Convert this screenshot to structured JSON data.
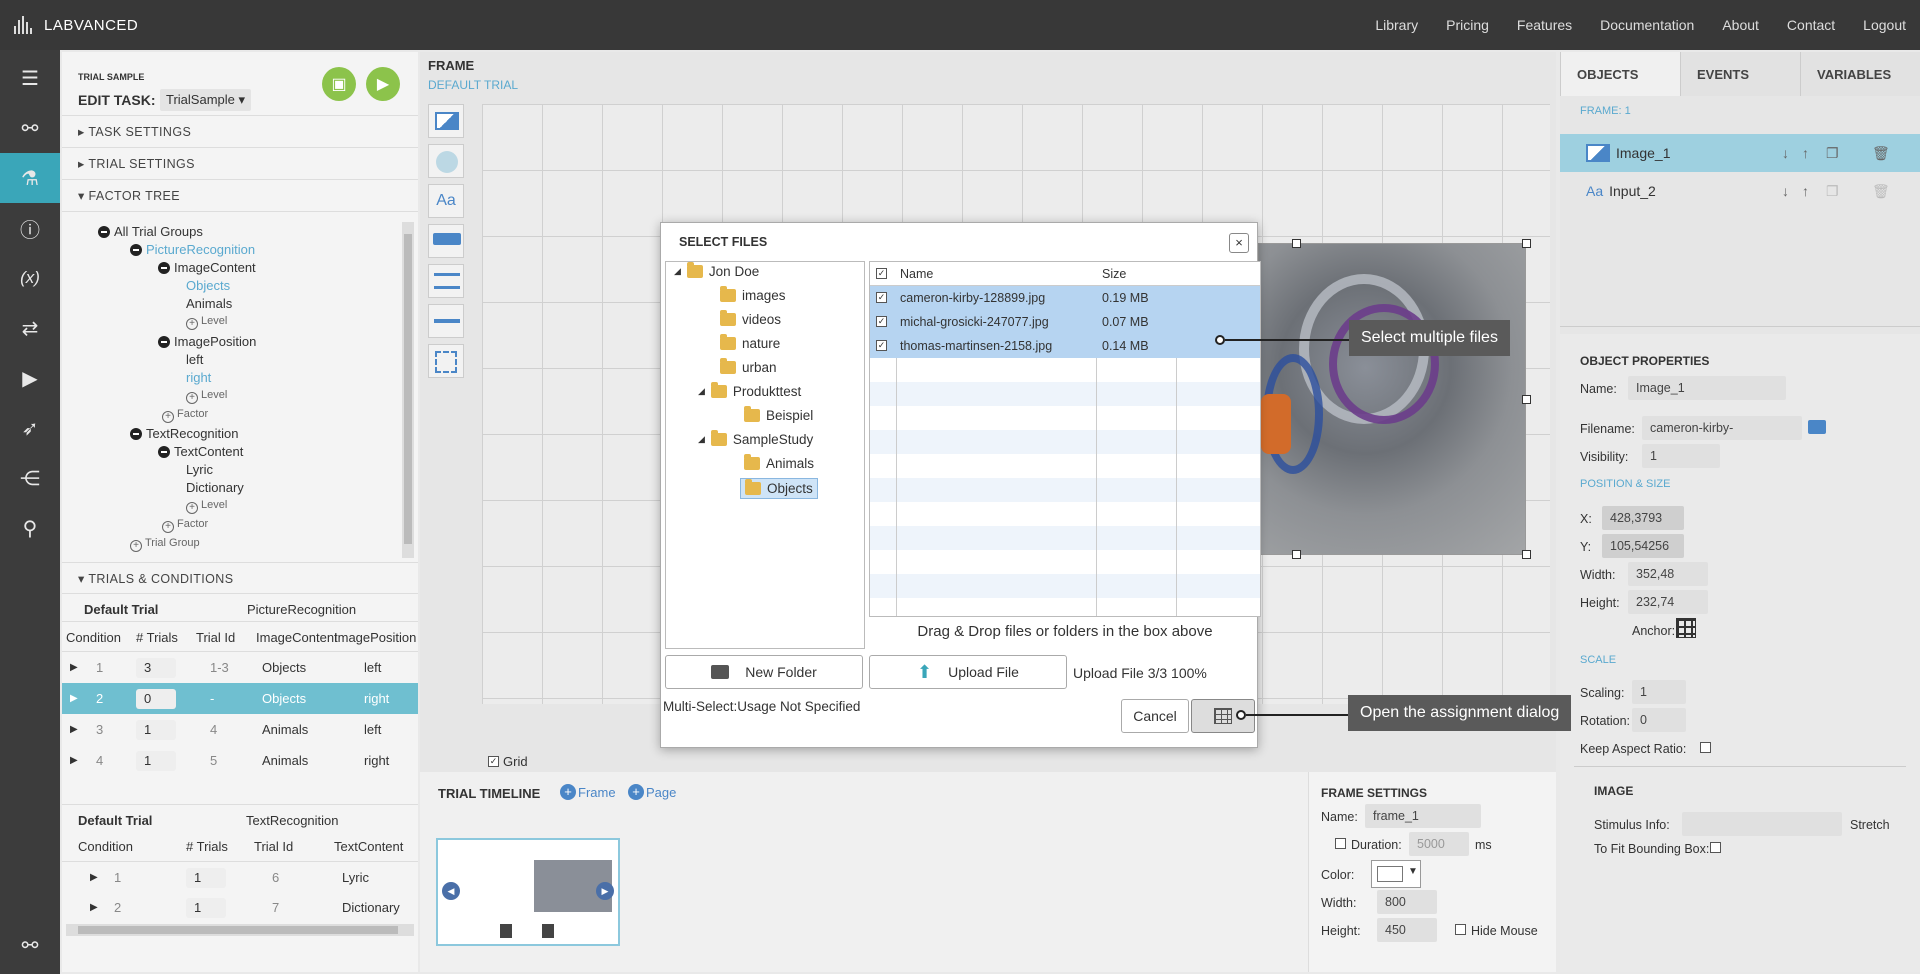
{
  "topbar": {
    "logo": "LABVANCED",
    "nav": [
      "Library",
      "Pricing",
      "Features",
      "Documentation",
      "About",
      "Contact",
      "Logout"
    ]
  },
  "task": {
    "label": "TRIAL SAMPLE",
    "edit": "EDIT TASK:",
    "selected": "TrialSample ▾"
  },
  "sections": {
    "task_settings": "▸ TASK SETTINGS",
    "trial_settings": "▸ TRIAL SETTINGS",
    "factor_tree": "▾ FACTOR TREE",
    "trials": "▾ TRIALS & CONDITIONS"
  },
  "tree": {
    "all": "All Trial Groups",
    "pic": "PictureRecognition",
    "ic": "ImageContent",
    "objects": "Objects",
    "animals": "Animals",
    "level": "Level",
    "ip": "ImagePosition",
    "left": "left",
    "right": "right",
    "factor": "Factor",
    "tr": "TextRecognition",
    "tc": "TextContent",
    "lyric": "Lyric",
    "dict": "Dictionary",
    "tg": "Trial Group"
  },
  "t1": {
    "group": "Default Trial",
    "name": "PictureRecognition",
    "headers": [
      "Condition",
      "# Trials",
      "Trial Id",
      "ImageContent",
      "ImagePosition"
    ],
    "rows": [
      [
        "1",
        "3",
        "1-3",
        "Objects",
        "left"
      ],
      [
        "2",
        "0",
        "-",
        "Objects",
        "right"
      ],
      [
        "3",
        "1",
        "4",
        "Animals",
        "left"
      ],
      [
        "4",
        "1",
        "5",
        "Animals",
        "right"
      ]
    ]
  },
  "t2": {
    "group": "Default Trial",
    "name": "TextRecognition",
    "headers": [
      "Condition",
      "# Trials",
      "Trial Id",
      "TextContent"
    ],
    "rows": [
      [
        "1",
        "1",
        "6",
        "Lyric"
      ],
      [
        "2",
        "1",
        "7",
        "Dictionary"
      ]
    ]
  },
  "frame": {
    "title": "FRAME",
    "sub": "DEFAULT TRIAL",
    "grid": "Grid"
  },
  "right": {
    "tabs": [
      "OBJECTS",
      "EVENTS",
      "VARIABLES"
    ],
    "frame_label": "FRAME: 1",
    "objects": [
      "Image_1",
      "Input_2"
    ],
    "props_title": "OBJECT PROPERTIES",
    "name_l": "Name:",
    "name_v": "Image_1",
    "file_l": "Filename:",
    "file_v": "cameron-kirby-",
    "vis_l": "Visibility:",
    "vis_v": "1",
    "pos_title": "POSITION & SIZE",
    "x_l": "X:",
    "x_v": "428,3793",
    "y_l": "Y:",
    "y_v": "105,54256",
    "w_l": "Width:",
    "w_v": "352,48",
    "h_l": "Height:",
    "h_v": "232,74",
    "anchor_l": "Anchor:",
    "scale_title": "SCALE",
    "sc_l": "Scaling:",
    "sc_v": "1",
    "rot_l": "Rotation:",
    "rot_v": "0",
    "ka_l": "Keep Aspect Ratio:",
    "img_title": "IMAGE",
    "stim_l": "Stimulus Info:",
    "stretch": "Stretch",
    "fit": "To Fit Bounding Box:"
  },
  "timeline": {
    "title": "TRIAL TIMELINE",
    "frame": "Frame",
    "page": "Page"
  },
  "fs": {
    "title": "FRAME SETTINGS",
    "name_l": "Name:",
    "name_v": "frame_1",
    "dur_l": "Duration:",
    "dur_v": "5000",
    "ms": "ms",
    "color_l": "Color:",
    "w_l": "Width:",
    "w_v": "800",
    "h_l": "Height:",
    "h_v": "450",
    "hide": "Hide Mouse"
  },
  "dialog": {
    "title": "SELECT FILES",
    "close": "×",
    "tree": [
      "Jon Doe",
      "images",
      "videos",
      "nature",
      "urban",
      "Produkttest",
      "Beispiel",
      "SampleStudy",
      "Animals",
      "Objects"
    ],
    "col_name": "Name",
    "col_size": "Size",
    "files": [
      {
        "name": "cameron-kirby-128899.jpg",
        "size": "0.19 MB"
      },
      {
        "name": "michal-grosicki-247077.jpg",
        "size": "0.07 MB"
      },
      {
        "name": "thomas-martinsen-2158.jpg",
        "size": "0.14 MB"
      }
    ],
    "drag": "Drag & Drop files or folders in the box above",
    "new_folder": "New Folder",
    "upload": "Upload File",
    "status": "Upload File 3/3 100%",
    "multi": "Multi-Select:Usage Not Specified",
    "cancel": "Cancel"
  },
  "callouts": {
    "multi": "Select multiple files",
    "assign": "Open the assignment dialog"
  },
  "colors": {
    "accent": "#3aa6b9",
    "green": "#8cc34b",
    "selected": "#b6d4f1",
    "dark": "#383838"
  }
}
